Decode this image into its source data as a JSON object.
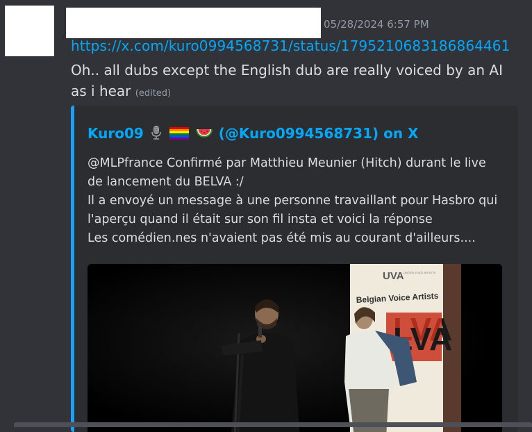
{
  "message": {
    "timestamp": "05/28/2024 6:57 PM",
    "link": "https://x.com/kuro0994568731/status/1795210683186864461",
    "text": "Oh.. all dubs except the English dub are really voiced by an AI as i hear",
    "edited_label": "(edited)"
  },
  "embed": {
    "author_name": "Kuro09",
    "author_handle": "(@Kuro0994568731) on X",
    "description_lines": [
      "@MLPfrance Confirmé par Matthieu Meunier (Hitch) durant le live",
      "de lancement du BELVA :/",
      "Il a envoyé un message à une personne travaillant pour Hasbro qui",
      "l'aperçu quand il était sur son fil insta et voici la réponse",
      "Les comédien.nes n'avaient pas été mis au courant d'ailleurs...."
    ],
    "accent_color": "#1da1f2",
    "image": {
      "banner_logo": "UVA",
      "banner_logo_sub": "UNITED VOICE ARTISTS",
      "banner_title": "Belgian Voice Artists",
      "banner_big": "LVA"
    }
  },
  "icons": {
    "author_emojis": [
      "microphone-icon",
      "rainbow-flag-icon",
      "watermelon-icon"
    ]
  },
  "colors": {
    "background": "#313338",
    "embed_background": "#2b2d31",
    "link": "#00a8fc",
    "muted": "#949ba4"
  }
}
